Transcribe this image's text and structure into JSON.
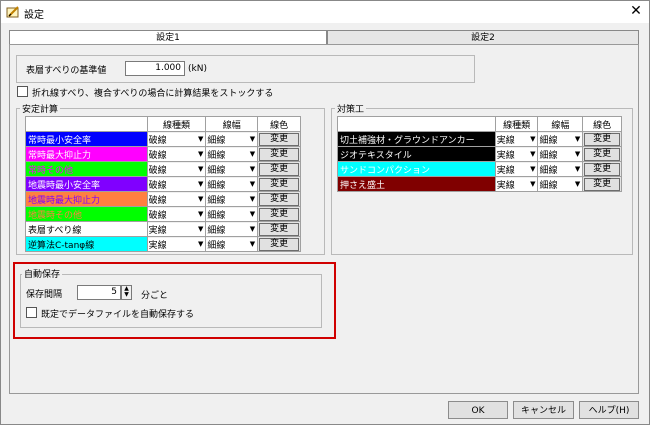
{
  "window": {
    "title": "設定",
    "close": "✕"
  },
  "tabs": [
    {
      "label": "設定1"
    },
    {
      "label": "設定2"
    }
  ],
  "base_value": {
    "label": "表層すべりの基準値",
    "value": "1.000",
    "unit": "(kN)"
  },
  "stock_option": {
    "label": "折れ線すべり、複合すべりの場合に計算結果をストックする",
    "checked": false
  },
  "stability": {
    "group_label": "安定計算",
    "header": {
      "line_type": "線種類",
      "line_width": "線幅",
      "line_color": "線色"
    },
    "rows": [
      {
        "name": "常時最小安全率",
        "bg": "#0000ff",
        "fg": "#ffffff",
        "line_type": "破線",
        "line_width": "細線",
        "button": "変更"
      },
      {
        "name": "常時最大抑止力",
        "bg": "#ff00ff",
        "fg": "#ffffff",
        "line_type": "破線",
        "line_width": "細線",
        "button": "変更"
      },
      {
        "name": "常時その他",
        "bg": "#00ff00",
        "fg": "#ff00ff",
        "line_type": "破線",
        "line_width": "細線",
        "button": "変更"
      },
      {
        "name": "地震時最小安全率",
        "bg": "#8000ff",
        "fg": "#ffffff",
        "line_type": "破線",
        "line_width": "細線",
        "button": "変更"
      },
      {
        "name": "地震時最大抑止力",
        "bg": "#ff8040",
        "fg": "#8000ff",
        "line_type": "破線",
        "line_width": "細線",
        "button": "変更"
      },
      {
        "name": "地震時その他",
        "bg": "#00ff00",
        "fg": "#ff8040",
        "line_type": "破線",
        "line_width": "細線",
        "button": "変更"
      },
      {
        "name": "表層すべり線",
        "bg": "#ffffff",
        "fg": "#000000",
        "line_type": "実線",
        "line_width": "細線",
        "button": "変更"
      },
      {
        "name": "逆算法C-tanφ線",
        "bg": "#00ffff",
        "fg": "#000000",
        "line_type": "実線",
        "line_width": "細線",
        "button": "変更"
      }
    ]
  },
  "countermeasure": {
    "group_label": "対策工",
    "header": {
      "line_type": "線種類",
      "line_width": "線幅",
      "line_color": "線色"
    },
    "rows": [
      {
        "name": "切土補強材・グラウンドアンカー",
        "bg": "#000000",
        "fg": "#ffffff",
        "line_type": "実線",
        "line_width": "細線",
        "button": "変更"
      },
      {
        "name": "ジオテキスタイル",
        "bg": "#000000",
        "fg": "#ffffff",
        "line_type": "実線",
        "line_width": "細線",
        "button": "変更"
      },
      {
        "name": "サンドコンパクション",
        "bg": "#00ffff",
        "fg": "#ffffff",
        "line_type": "実線",
        "line_width": "細線",
        "button": "変更"
      },
      {
        "name": "押さえ盛土",
        "bg": "#800000",
        "fg": "#ffffff",
        "line_type": "実線",
        "line_width": "細線",
        "button": "変更"
      }
    ]
  },
  "autosave": {
    "group_label": "自動保存",
    "interval_label": "保存間隔",
    "interval_value": "5",
    "interval_unit": "分ごと",
    "default_label": "既定でデータファイルを自動保存する",
    "default_checked": false
  },
  "buttons": {
    "ok": "OK",
    "cancel": "キャンセル",
    "help": "ヘルプ(H)"
  }
}
